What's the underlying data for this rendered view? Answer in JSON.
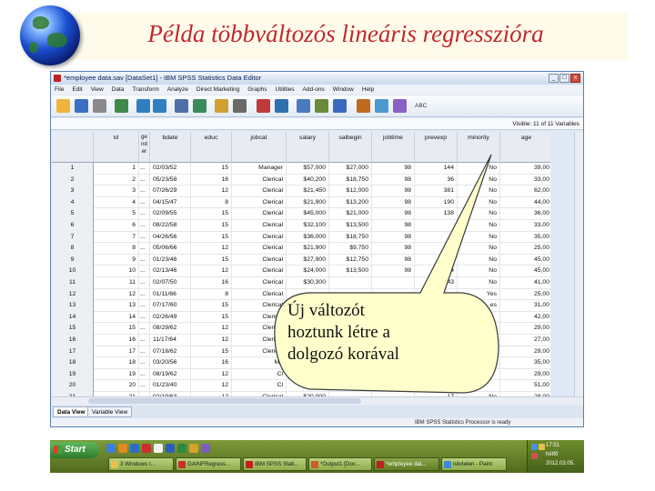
{
  "slide": {
    "title": "Példa többváltozós lineáris regresszióra"
  },
  "window": {
    "title": "*employee data.sav [DataSet1] - IBM SPSS Statistics Data Editor",
    "controls": [
      "_",
      "□",
      "x"
    ]
  },
  "menu": [
    "File",
    "Edit",
    "View",
    "Data",
    "Transform",
    "Analyze",
    "Direct Marketing",
    "Graphs",
    "Utilities",
    "Add-ons",
    "Window",
    "Help"
  ],
  "toolbar": {
    "icons": [
      "open-icon",
      "save-icon",
      "print-icon",
      "dialog-recall-icon",
      "undo-icon",
      "redo-icon",
      "goto-case-icon",
      "goto-variable-icon",
      "variables-icon",
      "find-icon",
      "insert-cases-icon",
      "insert-variable-icon",
      "split-file-icon",
      "weight-cases-icon",
      "select-cases-icon",
      "value-labels-icon",
      "use-sets-icon",
      "show-all-icon",
      "spell-check-icon"
    ],
    "spell_label": "ABC"
  },
  "visible": "Visible: 11 of 11 Variables",
  "columns": [
    "",
    "id",
    "ge nd er",
    "bdate",
    "educ",
    "jobcat",
    "salary",
    "salbegin",
    "jobtime",
    "prevexp",
    "minority",
    "age",
    "var"
  ],
  "rows": [
    [
      "1",
      "1",
      "...",
      "02/03/52",
      "15",
      "Manager",
      "$57,000",
      "$27,000",
      "98",
      "144",
      "No",
      "39,00"
    ],
    [
      "2",
      "2",
      "...",
      "05/23/58",
      "16",
      "Clerical",
      "$40,200",
      "$18,750",
      "98",
      "36",
      "No",
      "33,00"
    ],
    [
      "3",
      "3",
      "...",
      "07/26/29",
      "12",
      "Clerical",
      "$21,450",
      "$12,000",
      "98",
      "381",
      "No",
      "62,00"
    ],
    [
      "4",
      "4",
      "...",
      "04/15/47",
      "8",
      "Clerical",
      "$21,900",
      "$13,200",
      "98",
      "190",
      "No",
      "44,00"
    ],
    [
      "5",
      "5",
      "...",
      "02/09/55",
      "15",
      "Clerical",
      "$45,000",
      "$21,000",
      "98",
      "138",
      "No",
      "36,00"
    ],
    [
      "6",
      "6",
      "...",
      "08/22/58",
      "15",
      "Clerical",
      "$32,100",
      "$13,500",
      "98",
      "",
      "No",
      "33,00"
    ],
    [
      "7",
      "7",
      "...",
      "04/26/56",
      "15",
      "Clerical",
      "$36,000",
      "$18,750",
      "98",
      "",
      "No",
      "35,00"
    ],
    [
      "8",
      "8",
      "...",
      "05/06/66",
      "12",
      "Clerical",
      "$21,900",
      "$9,750",
      "98",
      "",
      "No",
      "25,00"
    ],
    [
      "9",
      "9",
      "...",
      "01/23/46",
      "15",
      "Clerical",
      "$27,900",
      "$12,750",
      "98",
      "",
      "No",
      "45,00"
    ],
    [
      "10",
      "10",
      "...",
      "02/13/46",
      "12",
      "Clerical",
      "$24,000",
      "$13,500",
      "98",
      "4",
      "No",
      "45,00"
    ],
    [
      "11",
      "11",
      "...",
      "02/07/50",
      "16",
      "Clerical",
      "$30,300",
      "",
      "",
      "43",
      "No",
      "41,00"
    ],
    [
      "12",
      "12",
      "...",
      "01/11/66",
      "8",
      "Clerical",
      "",
      "",
      "",
      "",
      "Yes",
      "25,00"
    ],
    [
      "13",
      "13",
      "...",
      "07/17/60",
      "15",
      "Clerical",
      "",
      "",
      "",
      "",
      "es",
      "31,00"
    ],
    [
      "14",
      "14",
      "...",
      "02/26/49",
      "15",
      "Clerical",
      "",
      "",
      "",
      "",
      "",
      "42,00"
    ],
    [
      "15",
      "15",
      "...",
      "08/29/62",
      "12",
      "Clerical",
      "",
      "",
      "",
      "",
      "",
      "29,00"
    ],
    [
      "16",
      "16",
      "...",
      "11/17/64",
      "12",
      "Clerical",
      "",
      "",
      "",
      "",
      "",
      "27,00"
    ],
    [
      "17",
      "17",
      "...",
      "07/18/62",
      "15",
      "Clerical",
      "",
      "",
      "",
      "",
      "",
      "29,00"
    ],
    [
      "18",
      "18",
      "...",
      "03/20/56",
      "16",
      "Ma",
      "",
      "",
      "",
      "",
      "",
      "35,00"
    ],
    [
      "19",
      "19",
      "...",
      "08/19/62",
      "12",
      "Cl",
      "",
      "",
      "",
      "",
      "",
      "29,00"
    ],
    [
      "20",
      "20",
      "...",
      "01/23/40",
      "12",
      "Cl",
      "",
      "",
      "",
      "",
      "",
      "51,00"
    ],
    [
      "21",
      "21",
      "...",
      "02/19/63",
      "12",
      "Clerical",
      "$20,000",
      "",
      "",
      "17",
      "No",
      "28,00"
    ]
  ],
  "tabs": {
    "data_view": "Data View",
    "variable_view": "Variable View"
  },
  "status": "IBM SPSS Statistics Processor is ready",
  "taskbar": {
    "start": "Start",
    "tasks": [
      "3 Windows I...",
      "GAINFRegress...",
      "IBM SPSS Stati...",
      "*Output1 [Doc...",
      "*employee dat...",
      "névtelen - Paint"
    ],
    "time": "17:51",
    "day": "hétfő",
    "date": "2012.03.05."
  },
  "callout": {
    "lines": [
      "Új változót",
      "hoztunk létre a",
      "dolgozó korával"
    ]
  },
  "colors": {
    "title": "#c0282e",
    "callout_fill": "#ffffcc",
    "taskbar": "#6b8a2a"
  }
}
